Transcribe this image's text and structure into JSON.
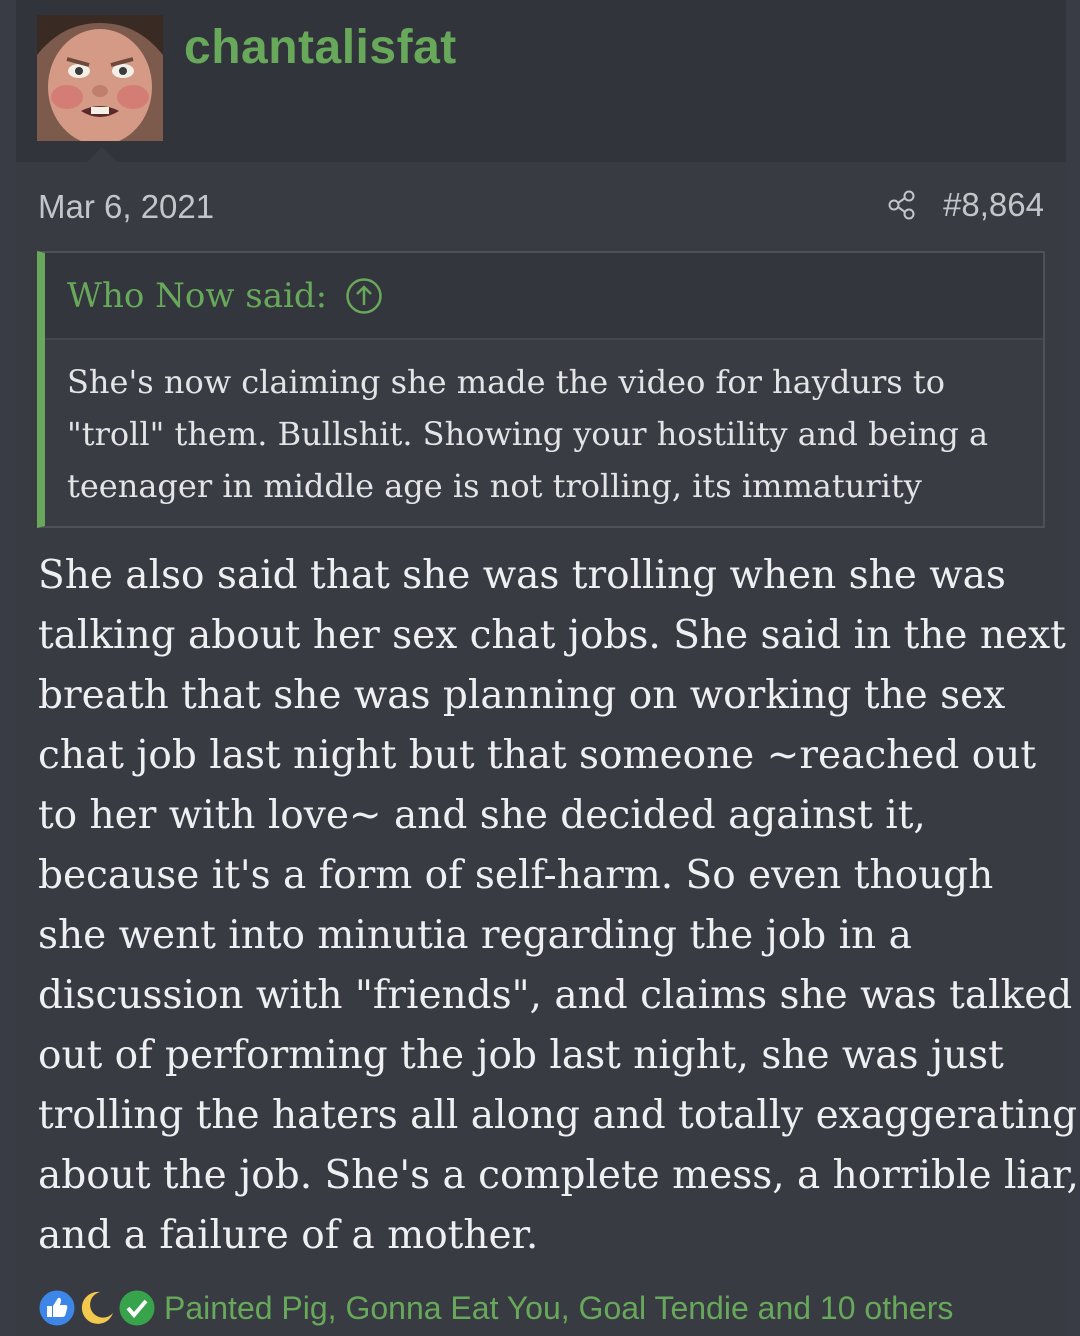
{
  "post": {
    "username": "chantalisfat",
    "date": "Mar 6, 2021",
    "post_number": "#8,864",
    "share_icon": "share-icon"
  },
  "quote": {
    "attribution": "Who Now said:",
    "jump_icon": "arrow-up-circle-icon",
    "lines": [
      "She's now claiming she made the video for haydurs to",
      "\"troll\" them. Bullshit. Showing your hostility and being a",
      "teenager in middle age is not trolling, its immaturity"
    ]
  },
  "message": {
    "lines": [
      "She also said that she was trolling when she was",
      "talking about her sex chat jobs. She said in the next",
      "breath that she was planning on working the sex",
      "chat job last night but that someone ~reached out",
      "to her with love~ and she decided against it,",
      "because it's a form of self-harm. So even though",
      "she went into minutia regarding the job in a",
      "discussion with \"friends\", and claims she was talked",
      "out of performing the job last night, she was just",
      "trolling the haters all along and totally exaggerating",
      "about the job. She's a complete mess, a horrible liar,",
      "and a failure of a mother."
    ]
  },
  "reactions": {
    "icons": [
      "thumbs-up-icon",
      "moon-icon",
      "check-icon"
    ],
    "users_text": "Painted Pig, Gonna Eat You, Goal Tendie and 10 others"
  },
  "colors": {
    "accent": "#67a85a",
    "background": "#383b42",
    "header_background": "#31343a",
    "text": "#eeeff1"
  }
}
